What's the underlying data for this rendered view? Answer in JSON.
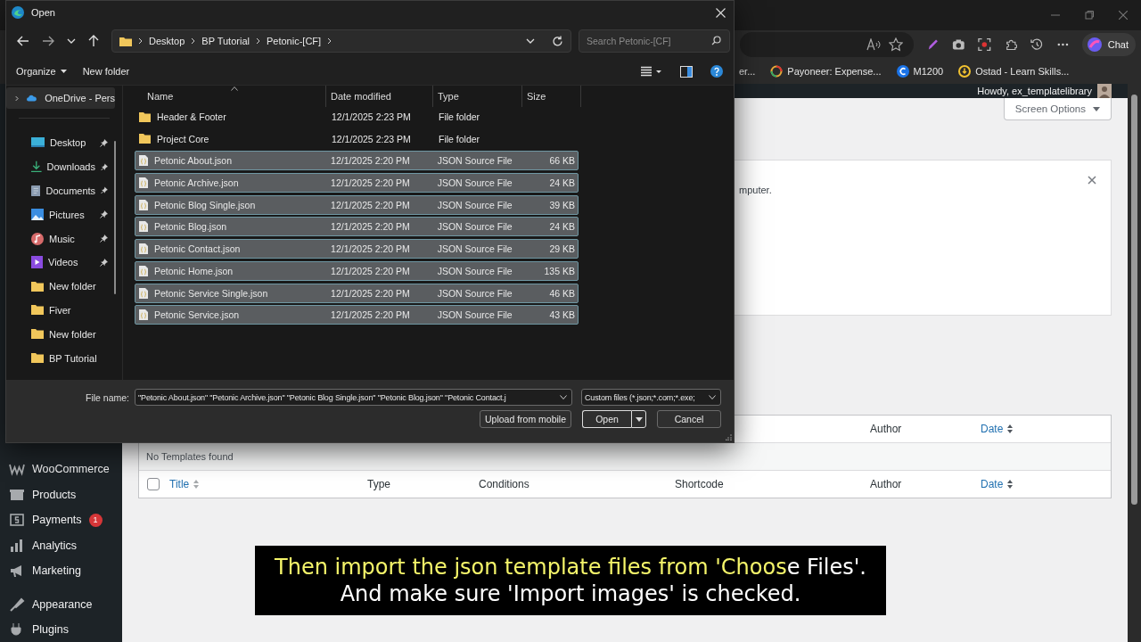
{
  "browser": {
    "chat_button": "Chat",
    "bookmarks": [
      {
        "label": "er..."
      },
      {
        "label": "Payoneer: Expense..."
      },
      {
        "label": "M1200"
      },
      {
        "label": "Ostad - Learn Skills..."
      }
    ]
  },
  "wp": {
    "greeting": "Howdy, ex_templatelibrary",
    "sidebar": [
      {
        "label": "WooCommerce"
      },
      {
        "label": "Products"
      },
      {
        "label": "Payments",
        "badge": "1"
      },
      {
        "label": "Analytics"
      },
      {
        "label": "Marketing"
      },
      {
        "label": "Appearance"
      },
      {
        "label": "Plugins"
      }
    ],
    "screen_options": "Screen Options",
    "notice_text": "mputer.",
    "table": {
      "header_columns": [
        {
          "label": "Author",
          "sortable": false
        },
        {
          "label": "Date",
          "sortable": true
        }
      ],
      "empty_message": "No Templates found",
      "select_all_checked": false,
      "footer_columns": [
        {
          "label": "Title",
          "sortable": true
        },
        {
          "label": "Type",
          "sortable": false
        },
        {
          "label": "Conditions",
          "sortable": false
        },
        {
          "label": "Shortcode",
          "sortable": false
        },
        {
          "label": "Author",
          "sortable": false
        },
        {
          "label": "Date",
          "sortable": true
        }
      ]
    }
  },
  "dialog": {
    "title": "Open",
    "breadcrumbs": [
      "Desktop",
      "BP Tutorial",
      "Petonic-[CF]"
    ],
    "search_placeholder": "Search Petonic-[CF]",
    "organize": "Organize",
    "new_folder": "New folder",
    "nav_pane": [
      {
        "label": "OneDrive - Pers",
        "kind": "cloud",
        "pinned": false,
        "selected": true
      },
      {
        "label": "Desktop",
        "kind": "desktop",
        "pinned": true,
        "selected": false
      },
      {
        "label": "Downloads",
        "kind": "download",
        "pinned": true,
        "selected": false
      },
      {
        "label": "Documents",
        "kind": "documents",
        "pinned": true,
        "selected": false
      },
      {
        "label": "Pictures",
        "kind": "pictures",
        "pinned": true,
        "selected": false
      },
      {
        "label": "Music",
        "kind": "music",
        "pinned": true,
        "selected": false
      },
      {
        "label": "Videos",
        "kind": "videos",
        "pinned": true,
        "selected": false
      },
      {
        "label": "New folder",
        "kind": "folder",
        "pinned": false,
        "selected": false
      },
      {
        "label": "Fiver",
        "kind": "folder",
        "pinned": false,
        "selected": false
      },
      {
        "label": "New folder",
        "kind": "folder",
        "pinned": false,
        "selected": false
      },
      {
        "label": "BP Tutorial",
        "kind": "folder",
        "pinned": false,
        "selected": false
      }
    ],
    "columns": [
      "Name",
      "Date modified",
      "Type",
      "Size"
    ],
    "files": [
      {
        "name": "Header & Footer",
        "date": "12/1/2025 2:23 PM",
        "type": "File folder",
        "kind": "folder",
        "selected": false
      },
      {
        "name": "Project Core",
        "date": "12/1/2025 2:23 PM",
        "type": "File folder",
        "kind": "folder",
        "selected": false
      },
      {
        "name": "Petonic About.json",
        "date": "12/1/2025 2:20 PM",
        "type": "JSON Source File",
        "size": "66 KB",
        "kind": "file",
        "selected": true
      },
      {
        "name": "Petonic Archive.json",
        "date": "12/1/2025 2:20 PM",
        "type": "JSON Source File",
        "size": "24 KB",
        "kind": "file",
        "selected": true
      },
      {
        "name": "Petonic Blog Single.json",
        "date": "12/1/2025 2:20 PM",
        "type": "JSON Source File",
        "size": "39 KB",
        "kind": "file",
        "selected": true
      },
      {
        "name": "Petonic Blog.json",
        "date": "12/1/2025 2:20 PM",
        "type": "JSON Source File",
        "size": "24 KB",
        "kind": "file",
        "selected": true
      },
      {
        "name": "Petonic Contact.json",
        "date": "12/1/2025 2:20 PM",
        "type": "JSON Source File",
        "size": "29 KB",
        "kind": "file",
        "selected": true
      },
      {
        "name": "Petonic Home.json",
        "date": "12/1/2025 2:20 PM",
        "type": "JSON Source File",
        "size": "135 KB",
        "kind": "file",
        "selected": true
      },
      {
        "name": "Petonic Service Single.json",
        "date": "12/1/2025 2:20 PM",
        "type": "JSON Source File",
        "size": "46 KB",
        "kind": "file",
        "selected": true
      },
      {
        "name": "Petonic Service.json",
        "date": "12/1/2025 2:20 PM",
        "type": "JSON Source File",
        "size": "43 KB",
        "kind": "file",
        "selected": true
      }
    ],
    "file_name_label": "File name:",
    "file_name": "\"Petonic About.json\" \"Petonic Archive.json\" \"Petonic Blog Single.json\" \"Petonic Blog.json\" \"Petonic Contact.j",
    "file_type": "Custom files (*.json;*.com;*.exe;",
    "upload_button": "Upload from mobile",
    "open_button": "Open",
    "cancel_button": "Cancel"
  },
  "subtitle": [
    {
      "segments": [
        {
          "text": "Then import the json template files from 'Choos",
          "highlighted": true
        },
        {
          "text": "e Files'.",
          "highlighted": false
        }
      ]
    },
    {
      "segments": [
        {
          "text": "And make sure 'Import images' is checked.",
          "highlighted": false
        }
      ]
    }
  ]
}
